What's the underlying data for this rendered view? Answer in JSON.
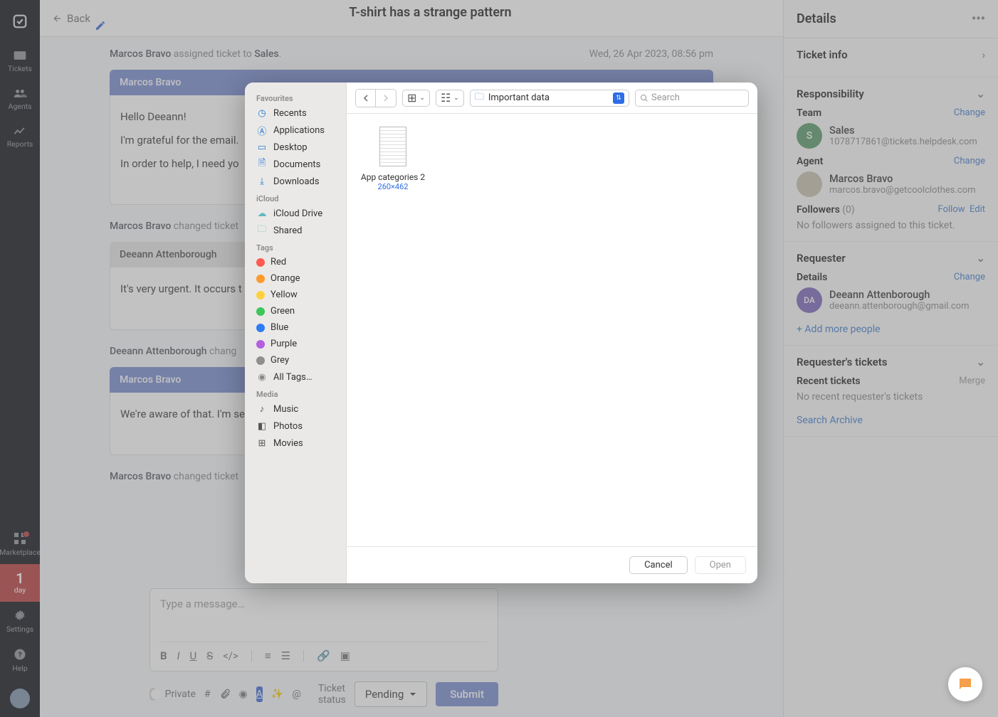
{
  "rail": {
    "items": [
      "Tickets",
      "Agents",
      "Reports"
    ],
    "marketplace": "Marketplace",
    "dayNum": "1",
    "dayLabel": "day",
    "settings": "Settings",
    "help": "Help"
  },
  "header": {
    "back": "Back",
    "title": "T-shirt has a strange pattern"
  },
  "thread": {
    "sys1": {
      "who": "Marcos Bravo",
      "action": " assigned ticket to ",
      "target": "Sales",
      "time": "Wed, 26 Apr 2023, 08:56 pm"
    },
    "msg1": {
      "author": "Marcos Bravo",
      "l1": "Hello Deeann!",
      "l2": "I'm grateful for the email.",
      "l3": "In order to help, I need yo"
    },
    "sys2": {
      "who": "Marcos Bravo",
      "action": " changed ticket"
    },
    "msg2": {
      "author": "Deeann Attenborough",
      "l1": "It's very urgent. It occurs t"
    },
    "sys3": {
      "who": "Deeann Attenborough",
      "action": " chang"
    },
    "msg3": {
      "author": "Marcos Bravo",
      "l1": "We're aware of that. I'm se"
    },
    "sys4": {
      "who": "Marcos Bravo",
      "action": " changed ticket"
    }
  },
  "composer": {
    "placeholder": "Type a message…",
    "private": "Private",
    "statusLabel": "Ticket status",
    "status": "Pending",
    "submit": "Submit"
  },
  "details": {
    "title": "Details",
    "ticketInfo": "Ticket info",
    "responsibility": "Responsibility",
    "teamLabel": "Team",
    "change": "Change",
    "teamName": "Sales",
    "teamEmail": "1078717861@tickets.helpdesk.com",
    "agentLabel": "Agent",
    "agentName": "Marcos Bravo",
    "agentEmail": "marcos.bravo@getcoolclothes.com",
    "followersLabel": "Followers",
    "followersCount": "(0)",
    "follow": "Follow",
    "edit": "Edit",
    "followersNone": "No followers assigned to this ticket.",
    "requester": "Requester",
    "detailsLbl": "Details",
    "reqName": "Deeann Attenborough",
    "reqEmail": "deeann.attenborough@gmail.com",
    "addMore": "+ Add more people",
    "reqTickets": "Requester's tickets",
    "recent": "Recent tickets",
    "merge": "Merge",
    "recentNone": "No recent requester's tickets",
    "searchArchive": "Search Archive"
  },
  "dialog": {
    "favourites": "Favourites",
    "fav": [
      "Recents",
      "Applications",
      "Desktop",
      "Documents",
      "Downloads"
    ],
    "icloud": "iCloud",
    "icloudItems": [
      "iCloud Drive",
      "Shared"
    ],
    "tagsH": "Tags",
    "tags": [
      {
        "name": "Red",
        "c": "#ff5b50"
      },
      {
        "name": "Orange",
        "c": "#ff9a2e"
      },
      {
        "name": "Yellow",
        "c": "#ffd23d"
      },
      {
        "name": "Green",
        "c": "#3dc65a"
      },
      {
        "name": "Blue",
        "c": "#2e7df6"
      },
      {
        "name": "Purple",
        "c": "#b45ee0"
      },
      {
        "name": "Grey",
        "c": "#8e8e8e"
      }
    ],
    "allTags": "All Tags…",
    "mediaH": "Media",
    "media": [
      "Music",
      "Photos",
      "Movies"
    ],
    "path": "Important data",
    "searchPh": "Search",
    "file": {
      "name": "App categories 2",
      "dim": "260×462"
    },
    "cancel": "Cancel",
    "open": "Open"
  }
}
